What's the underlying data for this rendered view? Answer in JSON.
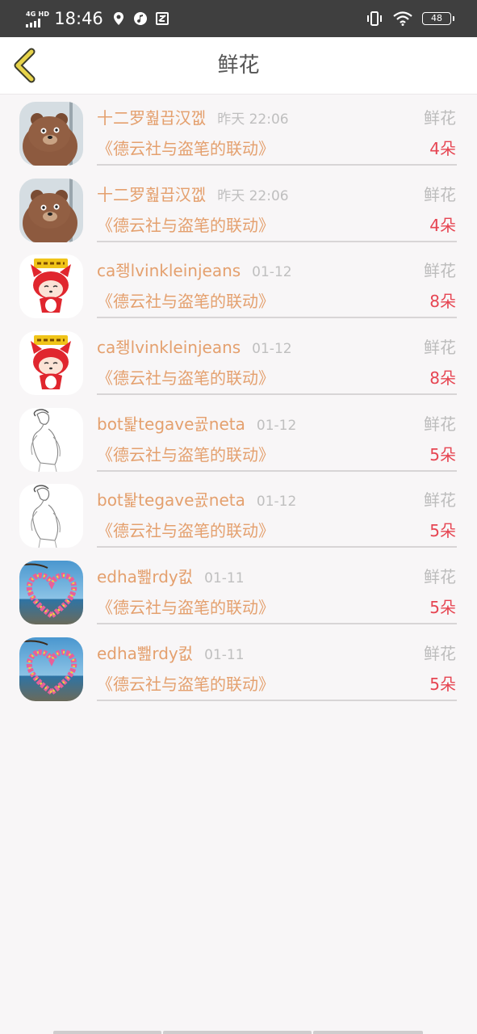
{
  "status_bar": {
    "network": "4G HD",
    "time": "18:46",
    "battery": "48",
    "icons": [
      "signal-icon",
      "location-icon",
      "music-icon",
      "screenshot-icon",
      "vibrate-icon",
      "wifi-icon",
      "battery-icon"
    ]
  },
  "header": {
    "title": "鲜花",
    "back_icon": "back-arrow-icon",
    "accent_color": "#e7d34a"
  },
  "records": [
    {
      "avatar": "brown-bear-avatar",
      "name": "十二罗훮끕汉껪",
      "time": "昨天 22:06",
      "kind": "鲜花",
      "work": "《德云社与盗笔的联动》",
      "count": "4朵"
    },
    {
      "avatar": "brown-bear-avatar",
      "name": "十二罗훮끕汉껪",
      "time": "昨天 22:06",
      "kind": "鲜花",
      "work": "《德云社与盗笔的联动》",
      "count": "4朵"
    },
    {
      "avatar": "red-fox-cartoon-avatar",
      "name": "ca좽lvinkleinjeans",
      "time": "01-12",
      "kind": "鲜花",
      "work": "《德云社与盗笔的联动》",
      "count": "8朵"
    },
    {
      "avatar": "red-fox-cartoon-avatar",
      "name": "ca좽lvinkleinjeans",
      "time": "01-12",
      "kind": "鲜花",
      "work": "《德云社与盗笔的联动》",
      "count": "8朵"
    },
    {
      "avatar": "sketch-figure-avatar",
      "name": "bot퇉tegave굜neta",
      "time": "01-12",
      "kind": "鲜花",
      "work": "《德云社与盗笔的联动》",
      "count": "5朵"
    },
    {
      "avatar": "sketch-figure-avatar",
      "name": "bot퇉tegave굜neta",
      "time": "01-12",
      "kind": "鲜花",
      "work": "《德云社与盗笔的联动》",
      "count": "5朵"
    },
    {
      "avatar": "heart-beach-avatar",
      "name": "edha뾆rdy컶",
      "time": "01-11",
      "kind": "鲜花",
      "work": "《德云社与盗笔的联动》",
      "count": "5朵"
    },
    {
      "avatar": "heart-beach-avatar",
      "name": "edha뾆rdy컶",
      "time": "01-11",
      "kind": "鲜花",
      "work": "《德云社与盗笔的联动》",
      "count": "5朵"
    }
  ],
  "colors": {
    "name_text": "#e4a06e",
    "count_text": "#e64552",
    "muted_text": "#bcbcbc",
    "background": "#f8f6f7"
  }
}
